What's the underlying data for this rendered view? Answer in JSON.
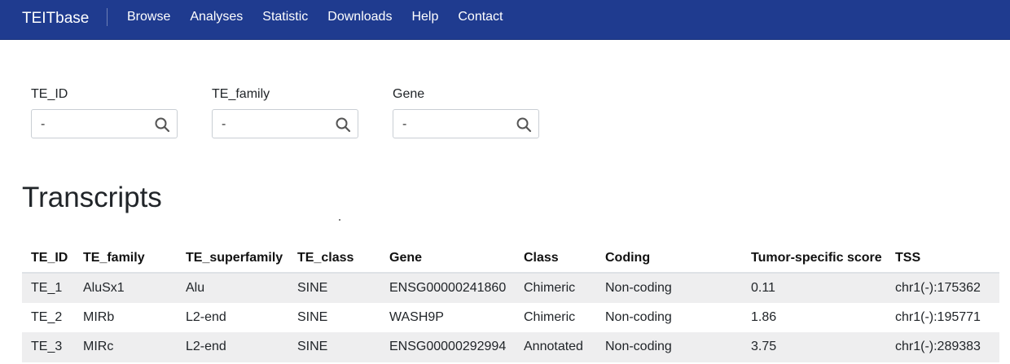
{
  "nav": {
    "brand": "TEITbase",
    "links": [
      "Browse",
      "Analyses",
      "Statistic",
      "Downloads",
      "Help",
      "Contact"
    ]
  },
  "filters": [
    {
      "label": "TE_ID",
      "value": "-"
    },
    {
      "label": "TE_family",
      "value": "-"
    },
    {
      "label": "Gene",
      "value": "-"
    }
  ],
  "page_title": "Transcripts",
  "table": {
    "headers": [
      "TE_ID",
      "TE_family",
      "TE_superfamily",
      "TE_class",
      "Gene",
      "Class",
      "Coding",
      "Tumor-specific score",
      "TSS"
    ],
    "rows": [
      [
        "TE_1",
        "AluSx1",
        "Alu",
        "SINE",
        "ENSG00000241860",
        "Chimeric",
        "Non-coding",
        "0.11",
        "chr1(-):175362"
      ],
      [
        "TE_2",
        "MIRb",
        "L2-end",
        "SINE",
        "WASH9P",
        "Chimeric",
        "Non-coding",
        "1.86",
        "chr1(-):195771"
      ],
      [
        "TE_3",
        "MIRc",
        "L2-end",
        "SINE",
        "ENSG00000292994",
        "Annotated",
        "Non-coding",
        "3.75",
        "chr1(-):289383"
      ]
    ]
  },
  "colors": {
    "navbar": "#1f3b8f",
    "link": "#2c63b6",
    "stripe": "#eeeeef"
  },
  "icons": {
    "filter_icon": "search-icon"
  }
}
